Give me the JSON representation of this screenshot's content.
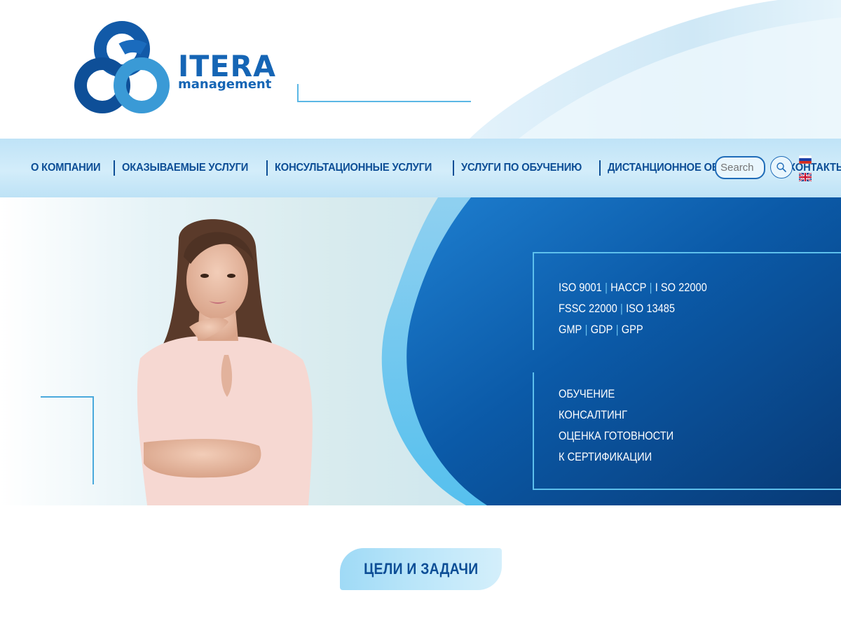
{
  "brand": {
    "name": "ITERA",
    "subtitle": "management",
    "colors": {
      "primary": "#1565b5",
      "dark": "#0d4e96",
      "accent": "#5ec0ec",
      "light": "#bfe3f7"
    }
  },
  "nav": {
    "items": [
      {
        "label": "О КОМПАНИИ"
      },
      {
        "label": "ОКАЗЫВАЕМЫЕ УСЛУГИ"
      },
      {
        "label": "КОНСУЛЬТАЦИОННЫЕ УСЛУГИ"
      },
      {
        "label": "УСЛУГИ ПО ОБУЧЕНИЮ"
      },
      {
        "label": "ДИСТАНЦИОННОЕ ОБУЧЕНИЕ"
      },
      {
        "label": "КОНТАКТЫ"
      }
    ]
  },
  "search": {
    "placeholder": "Search",
    "icon": "search-icon"
  },
  "languages": [
    {
      "code": "ru",
      "icon": "flag-ru-icon"
    },
    {
      "code": "en",
      "icon": "flag-uk-icon"
    }
  ],
  "hero": {
    "standards": [
      [
        "ISO 9001",
        "HACCP",
        "I SO 22000"
      ],
      [
        "FSSC 22000",
        "ISO 13485"
      ],
      [
        "GMP",
        "GDP",
        "GPP"
      ]
    ],
    "services": [
      "ОБУЧЕНИЕ",
      "КОНСАЛТИНГ",
      "ОЦЕНКА ГОТОВНОСТИ",
      "К СЕРТИФИКАЦИИ"
    ]
  },
  "goals": {
    "label": "ЦЕЛИ И ЗАДАЧИ"
  }
}
